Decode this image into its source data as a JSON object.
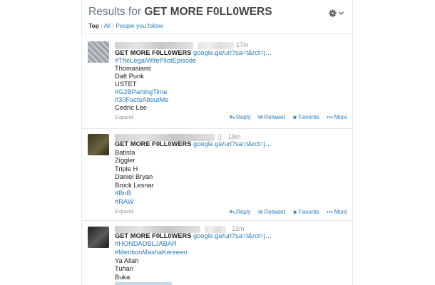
{
  "header": {
    "title_prefix": "Results for",
    "title_query": "GET MORE F0LL0WERS",
    "filters": {
      "top": "Top",
      "sep1": "/",
      "all": "All",
      "sep2": "/",
      "people": "People you follow"
    }
  },
  "tweets": [
    {
      "time": "17m",
      "headline": "GET MORE F0LL0WERS",
      "link": "google.ge/url?sa=t&rct=j…",
      "lines": [
        "#TheLegalWifePilotEpisode",
        "Thomasians",
        "Daft Punk",
        "USTET",
        "#G2BPartingTime",
        "#30FactsAboutMe",
        "Cedric Lee"
      ],
      "expand": "Expand"
    },
    {
      "time": "18m",
      "headline": "GET MORE F0LL0WERS",
      "link": "google.ge/url?sa=t&rct=j…",
      "lines": [
        "Batista",
        "Ziggler",
        "Triple H",
        "Daniel Bryan",
        "Brock Lesnar",
        "#BnB",
        "#RAW"
      ],
      "expand": "Expand"
    },
    {
      "time": "22m",
      "headline": "GET MORE F0LL0WERS",
      "link": "google.ge/url?sa=t&rct=j…",
      "lines": [
        "#HONDADBLJABAR",
        "#MentionMashaKereeen",
        "Ya Allah",
        "Tuhan",
        "Buka"
      ],
      "expand": ""
    }
  ],
  "actions": {
    "reply": "Reply",
    "retweet": "Retweet",
    "favorite": "Favorite",
    "more": "More"
  },
  "colors": {
    "link": "#2b7bb9",
    "favorite_star": "#2b7bb9"
  },
  "icons": [
    "gear-icon",
    "chevron-down-icon",
    "reply-icon",
    "retweet-icon",
    "star-icon",
    "more-icon"
  ]
}
